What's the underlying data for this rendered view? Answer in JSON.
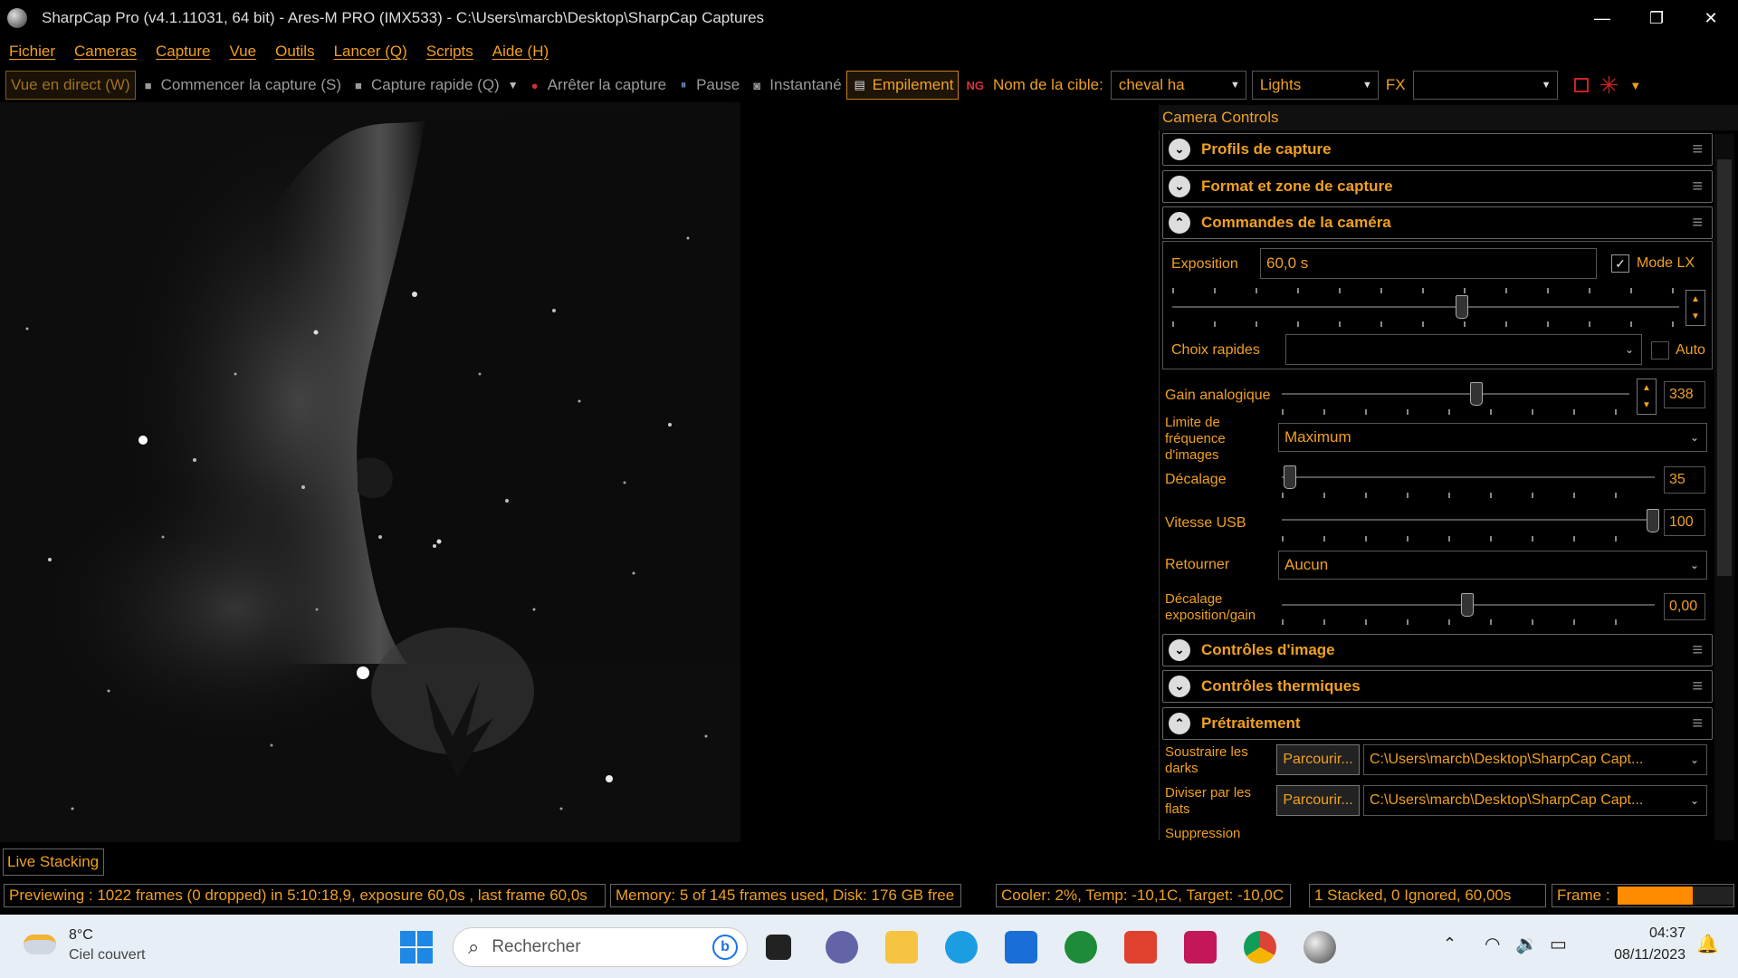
{
  "window": {
    "title": "SharpCap Pro (v4.1.11031, 64 bit) - Ares-M PRO (IMX533) - C:\\Users\\marcb\\Desktop\\SharpCap Captures",
    "minimize": "—",
    "restore": "❐",
    "close": "✕"
  },
  "menu": [
    "Fichier",
    "Cameras",
    "Capture",
    "Vue",
    "Outils",
    "Lancer (Q)",
    "Scripts",
    "Aide (H)"
  ],
  "toolbar": {
    "live_view": "Vue en direct (W)",
    "start_capture": "Commencer la capture (S)",
    "quick_capture": "Capture rapide (Q)",
    "stop_capture": "Arrêter la capture",
    "pause": "Pause",
    "snapshot": "Instantané",
    "stacking": "Empilement",
    "target_label": "Nom de la cible:",
    "target_value": "cheval ha",
    "frame_type": "Lights",
    "fx_label": "FX",
    "fx_value": ""
  },
  "panel": {
    "header": "Camera Controls",
    "sections": {
      "capture_profiles": "Profils de capture",
      "format_area": "Format et zone de capture",
      "camera_commands": "Commandes de la caméra",
      "image_controls": "Contrôles d'image",
      "thermal_controls": "Contrôles thermiques",
      "preprocessing": "Prétraitement"
    },
    "exposure": {
      "label": "Exposition",
      "value": "60,0 s",
      "lx_label": "Mode LX",
      "lx_checked": true
    },
    "quick_choices": {
      "label": "Choix rapides",
      "value": "",
      "auto_label": "Auto"
    },
    "gain": {
      "label": "Gain analogique",
      "value": "338"
    },
    "frame_rate_limit": {
      "label": "Limite de fréquence d'images",
      "value": "Maximum"
    },
    "offset": {
      "label": "Décalage",
      "value": "35"
    },
    "usb_speed": {
      "label": "Vitesse USB",
      "value": "100"
    },
    "flip": {
      "label": "Retourner",
      "value": "Aucun"
    },
    "exposure_gain_offset": {
      "label": "Décalage exposition/gain",
      "value": "0,00"
    },
    "darks": {
      "label": "Soustraire les darks",
      "browse": "Parcourir...",
      "path": "C:\\Users\\marcb\\Desktop\\SharpCap Capt..."
    },
    "flats": {
      "label": "Diviser par les flats",
      "browse": "Parcourir...",
      "path": "C:\\Users\\marcb\\Desktop\\SharpCap Capt..."
    },
    "suppression": {
      "label": "Suppression"
    }
  },
  "live_stacking_tab": "Live Stacking",
  "status": {
    "preview": "Previewing : 1022 frames (0 dropped) in 5:10:18,9, exposure 60,0s , last frame 60,0s",
    "memory": "Memory: 5 of 145 frames used, Disk: 176 GB free",
    "cooler": "Cooler: 2%, Temp: -10,1C, Target: -10,0C",
    "stacked": "1 Stacked, 0 Ignored, 60,00s",
    "frame_label": "Frame :",
    "frame_progress": 0.65
  },
  "taskbar": {
    "weather_temp": "8°C",
    "weather_desc": "Ciel couvert",
    "search_placeholder": "Rechercher",
    "time": "04:37",
    "date": "08/11/2023"
  },
  "colors": {
    "accent": "#f0a020",
    "background": "#000000",
    "taskbar": "#e8eef5"
  }
}
